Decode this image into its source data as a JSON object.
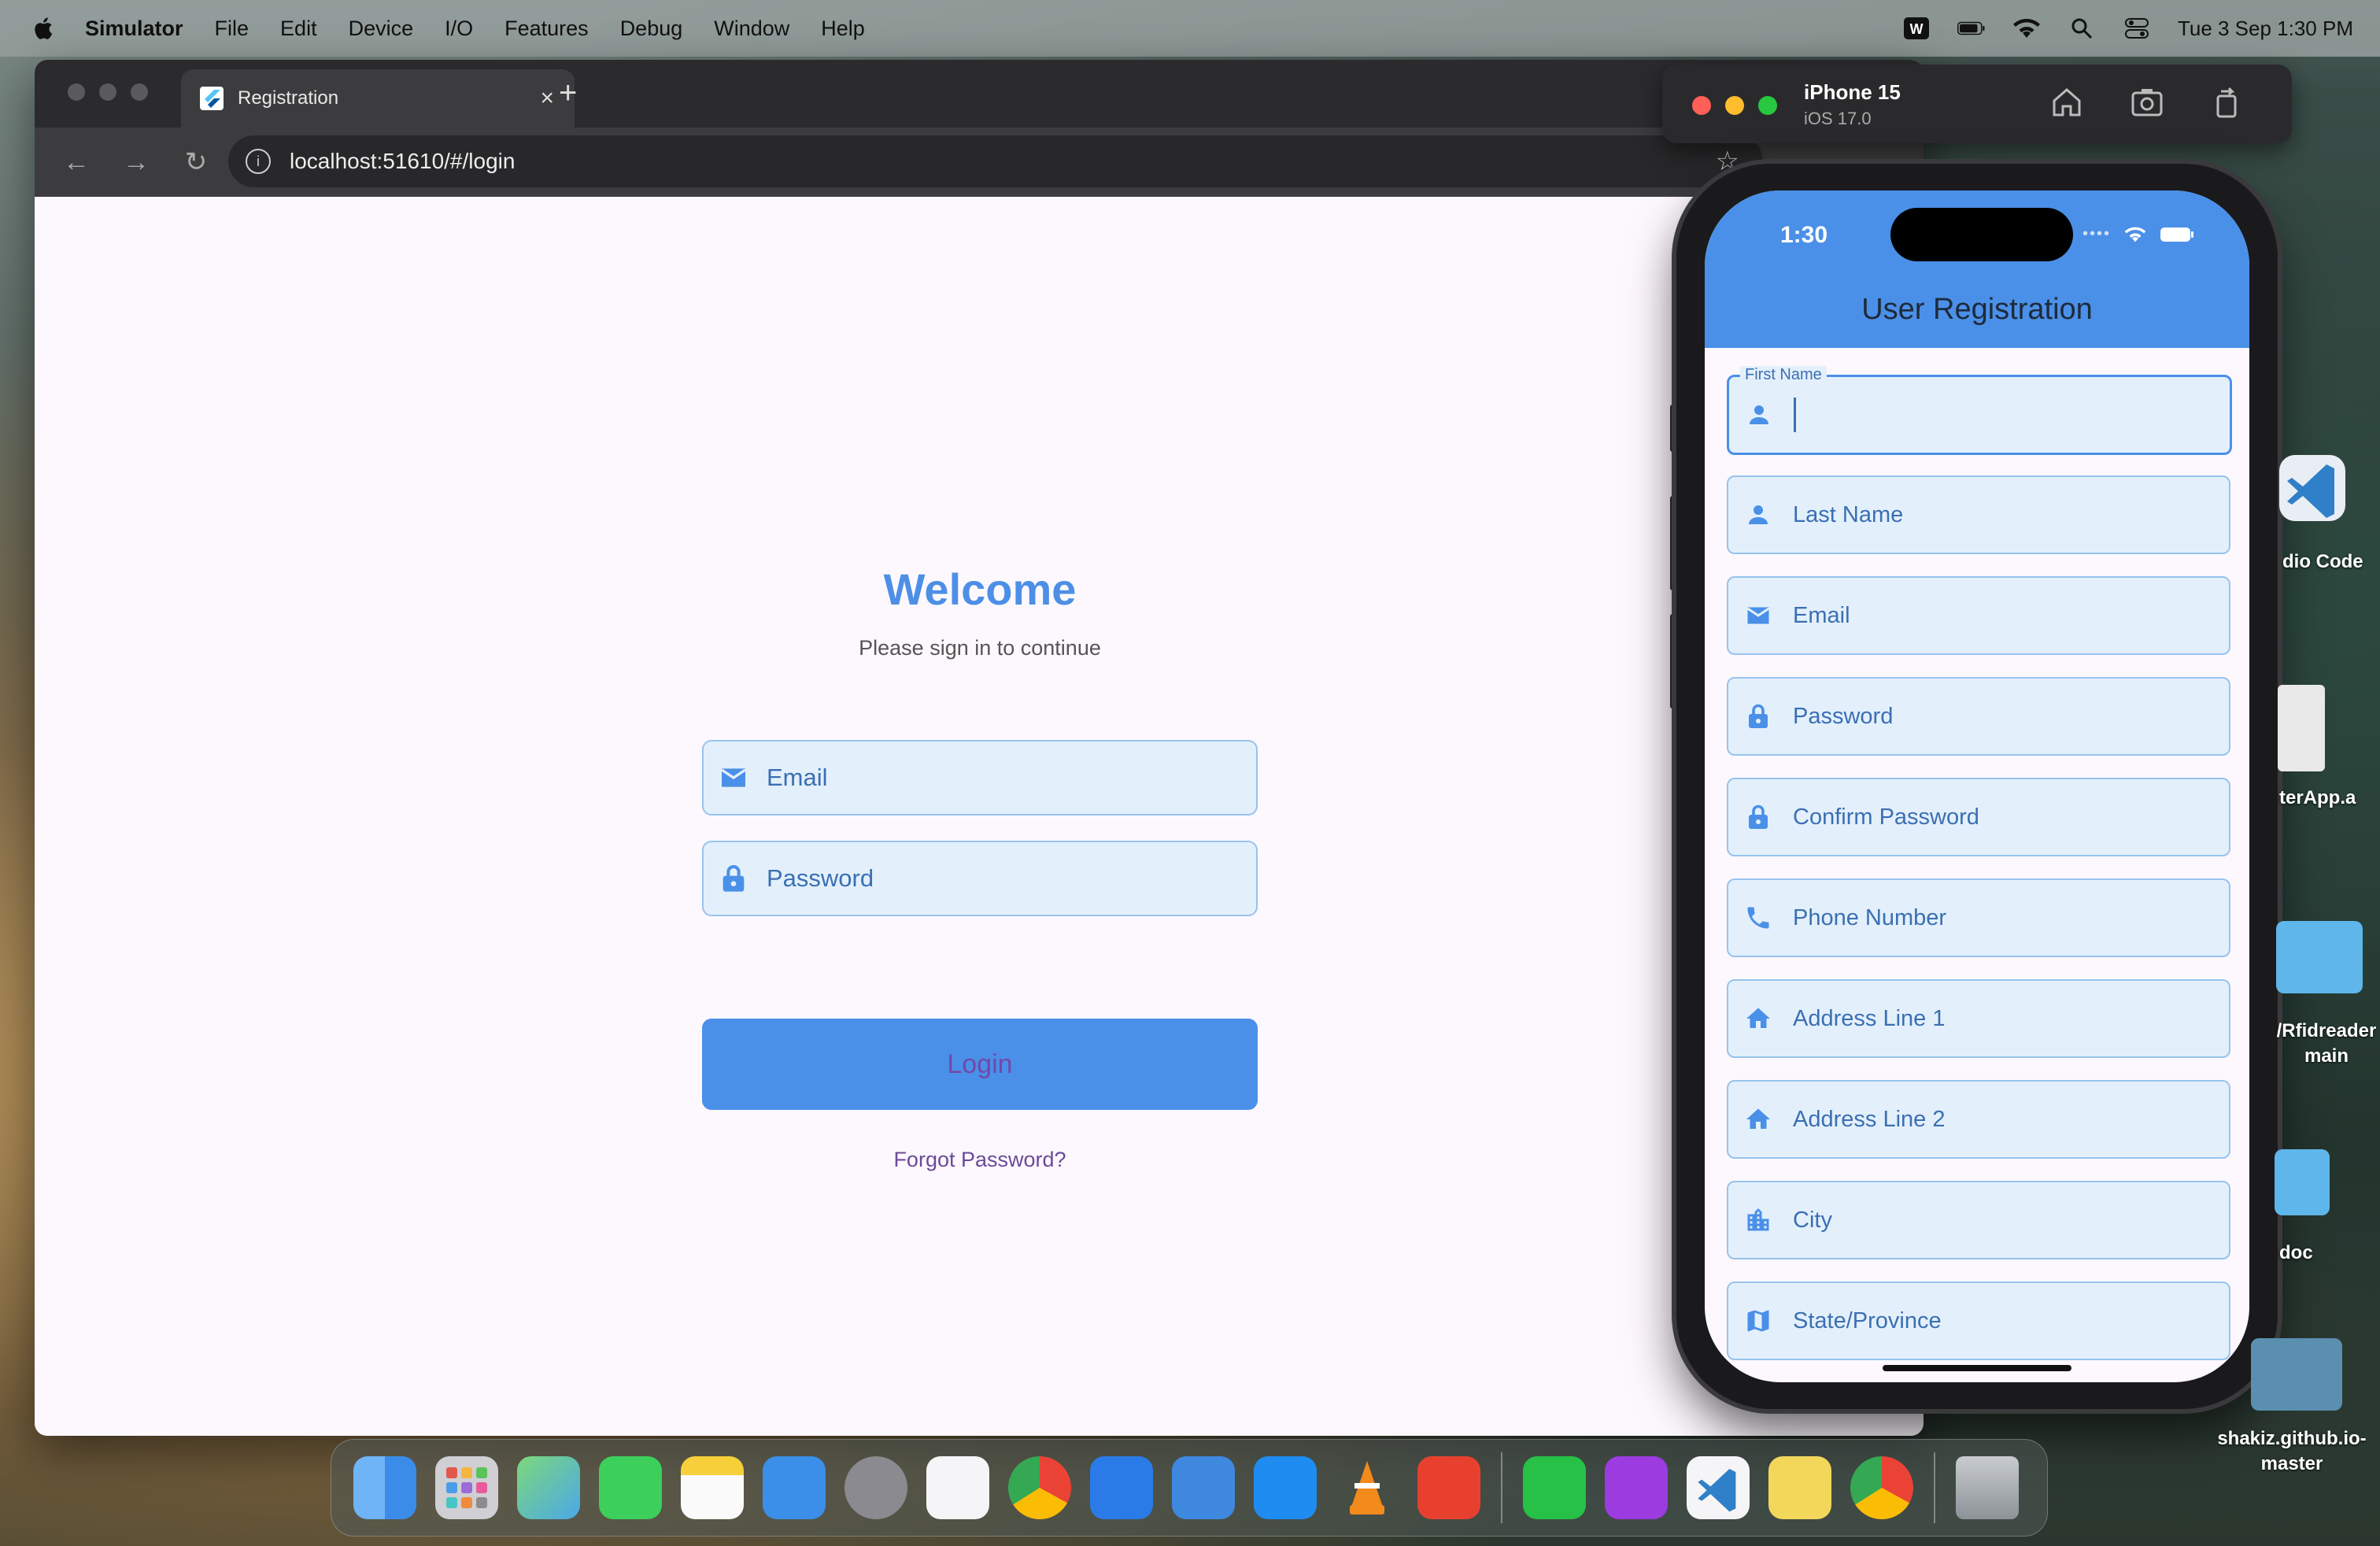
{
  "menubar": {
    "app_name": "Simulator",
    "items": [
      "File",
      "Edit",
      "Device",
      "I/O",
      "Features",
      "Debug",
      "Window",
      "Help"
    ],
    "clock": "Tue 3 Sep  1:30 PM"
  },
  "browser": {
    "tab_title": "Registration",
    "url": "localhost:51610/#/login"
  },
  "login_page": {
    "title": "Welcome",
    "subtitle": "Please sign in to continue",
    "email_label": "Email",
    "password_label": "Password",
    "login_button": "Login",
    "forgot_link": "Forgot Password?"
  },
  "simulator": {
    "device_name": "iPhone 15",
    "os_version": "iOS 17.0"
  },
  "phone": {
    "status_time": "1:30",
    "app_title": "User Registration",
    "focused_field_label": "First Name",
    "fields": [
      {
        "label": "Last Name",
        "icon": "person-icon"
      },
      {
        "label": "Email",
        "icon": "mail-icon"
      },
      {
        "label": "Password",
        "icon": "lock-icon"
      },
      {
        "label": "Confirm Password",
        "icon": "lock-icon"
      },
      {
        "label": "Phone Number",
        "icon": "phone-icon"
      },
      {
        "label": "Address Line 1",
        "icon": "home-icon"
      },
      {
        "label": "Address Line 2",
        "icon": "home-icon"
      },
      {
        "label": "City",
        "icon": "city-icon"
      },
      {
        "label": "State/Province",
        "icon": "map-icon"
      }
    ]
  },
  "desktop_icons": [
    {
      "label": "dio Code"
    },
    {
      "label": "terApp.a"
    },
    {
      "label": "/Rfidreader\nmain"
    },
    {
      "label": "doc"
    },
    {
      "label": "shakiz.github.io-\nmaster"
    }
  ],
  "colors": {
    "accent": "#4a90e8",
    "field_fill": "#e3f0fb",
    "field_text": "#3b6fb3",
    "link": "#6a4a98"
  }
}
